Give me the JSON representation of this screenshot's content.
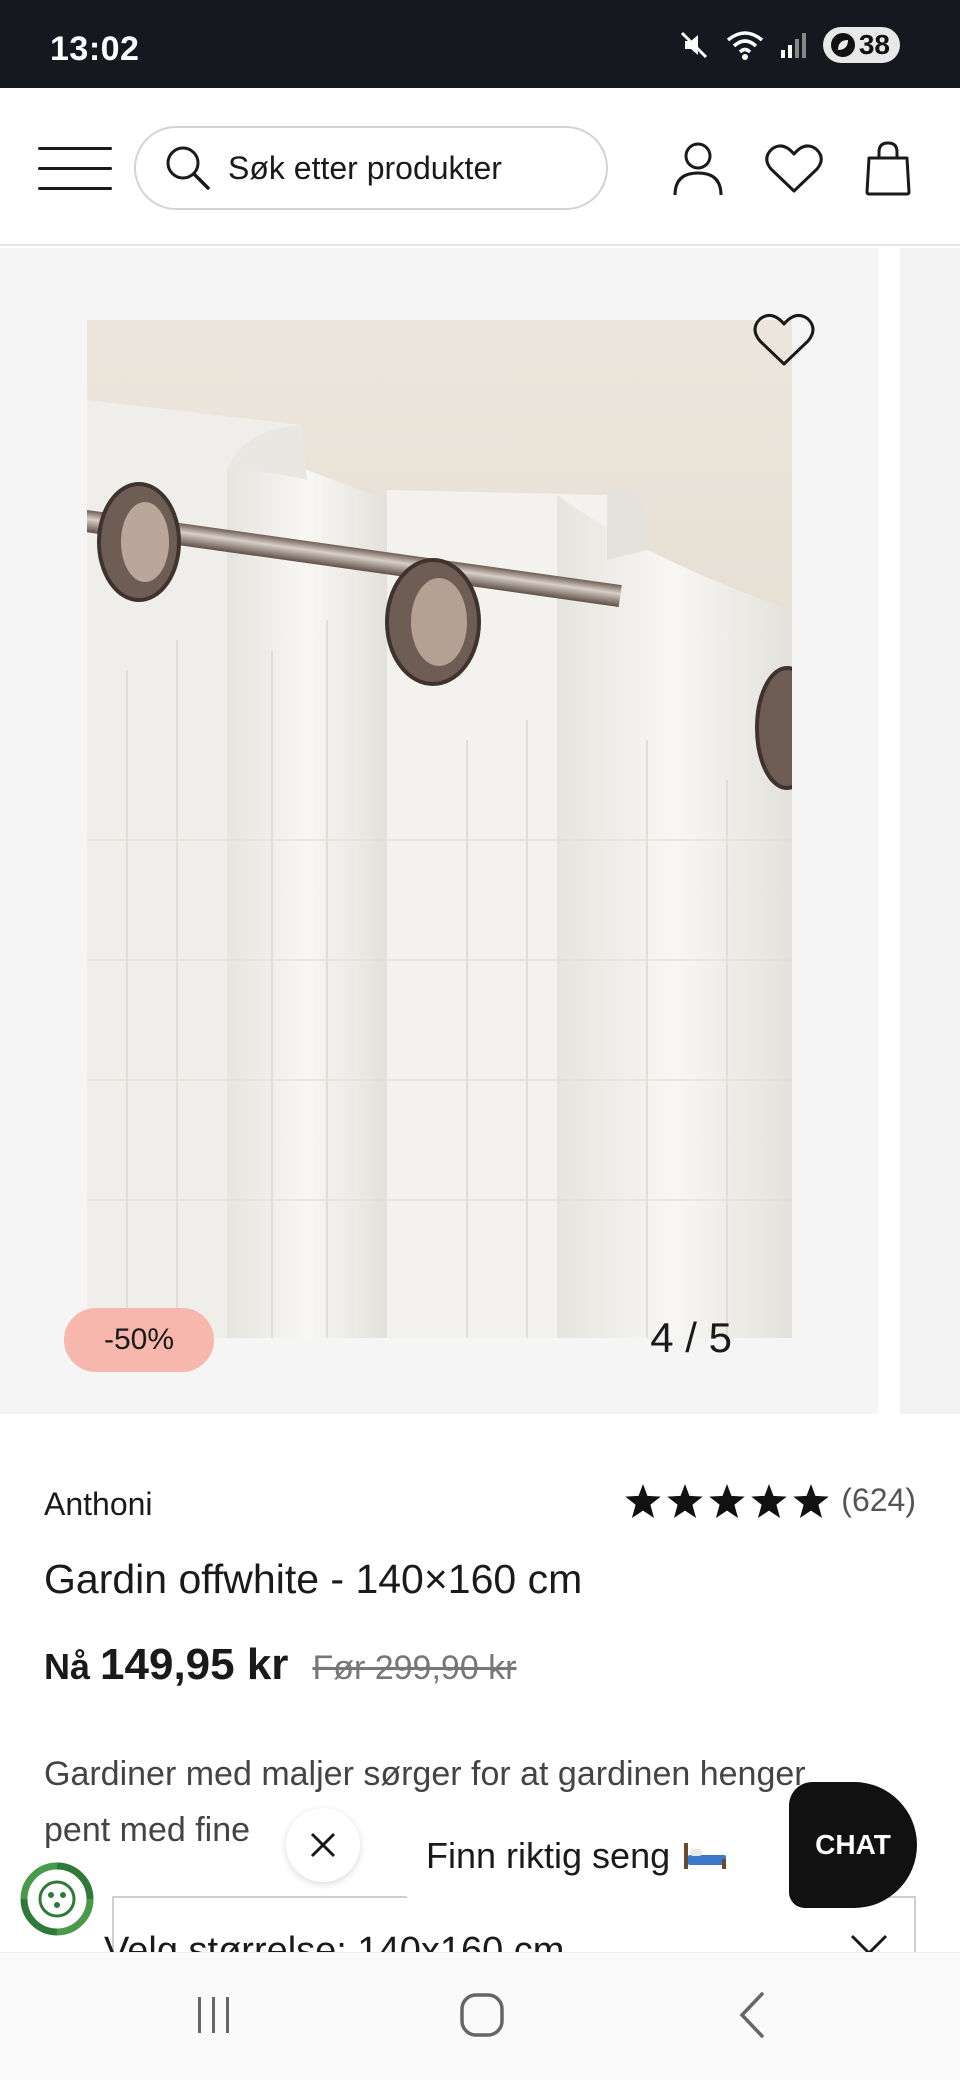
{
  "status_bar": {
    "time": "13:02",
    "battery": "38",
    "icons": [
      "mute-icon",
      "wifi-icon",
      "signal-icon",
      "battery-icon"
    ]
  },
  "header": {
    "search_placeholder": "Søk etter produkter",
    "icons": [
      "menu-icon",
      "search-icon",
      "account-icon",
      "wishlist-icon",
      "cart-icon"
    ]
  },
  "gallery": {
    "discount_badge": "-50%",
    "counter": "4 / 5",
    "current_image": 4,
    "total_images": 5
  },
  "product": {
    "brand": "Anthoni",
    "rating_stars": 5,
    "rating_count": "(624)",
    "title": "Gardin offwhite - 140×160 cm",
    "price_now_label": "Nå",
    "price_now": "149,95 kr",
    "price_before": "Før 299,90 kr",
    "description_line1": "Gardiner med maljer sørger for at gardinen henger",
    "description_line2": "pent med fine"
  },
  "size_selector": {
    "label": "Velg størrelse: 140x160 cm"
  },
  "promo": {
    "text": "Finn riktig seng",
    "emoji": "bed-icon"
  },
  "chat": {
    "label": "CHAT"
  },
  "colors": {
    "status_bar_bg": "#161820",
    "discount_badge_bg": "#f7b7ad",
    "chat_bg": "#111111",
    "sustain_green": "#2f7a3a"
  }
}
